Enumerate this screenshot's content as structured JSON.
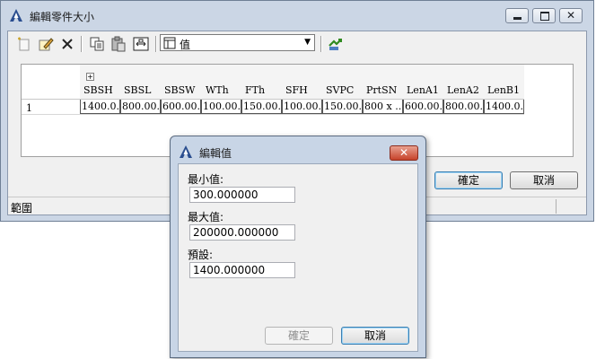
{
  "main_window": {
    "title": "編輯零件大小",
    "toolbar": {
      "buttons": [
        "new-row-icon",
        "edit-icon",
        "delete-icon",
        "copy-icon",
        "paste-icon",
        "fit-icon",
        "link-icon"
      ],
      "combo_value": "值"
    },
    "grid": {
      "columns": [
        "SBSH",
        "SBSL",
        "SBSW",
        "WTh",
        "FTh",
        "SFH",
        "SVPC",
        "PrtSN",
        "LenA1",
        "LenA2",
        "LenB1"
      ],
      "rows": [
        {
          "index": "1",
          "cells": [
            "1400.0...",
            "800.00...",
            "600.00...",
            "100.00...",
            "150.00...",
            "100.00...",
            "150.00...",
            "800 x ...",
            "600.00...",
            "800.00...",
            "1400.0..."
          ]
        }
      ]
    },
    "ok_label": "確定",
    "cancel_label": "取消",
    "status_text": "範圍"
  },
  "dialog": {
    "title": "編輯值",
    "min_label": "最小值:",
    "min_value": "300.000000",
    "max_label": "最大值:",
    "max_value": "200000.000000",
    "default_label": "預設:",
    "default_value": "1400.000000",
    "ok_label": "確定",
    "cancel_label": "取消"
  },
  "colors": {
    "title_bar": "#cbd6e5",
    "dialog_close": "#c7432a",
    "primary_border": "#3c7fb1"
  }
}
